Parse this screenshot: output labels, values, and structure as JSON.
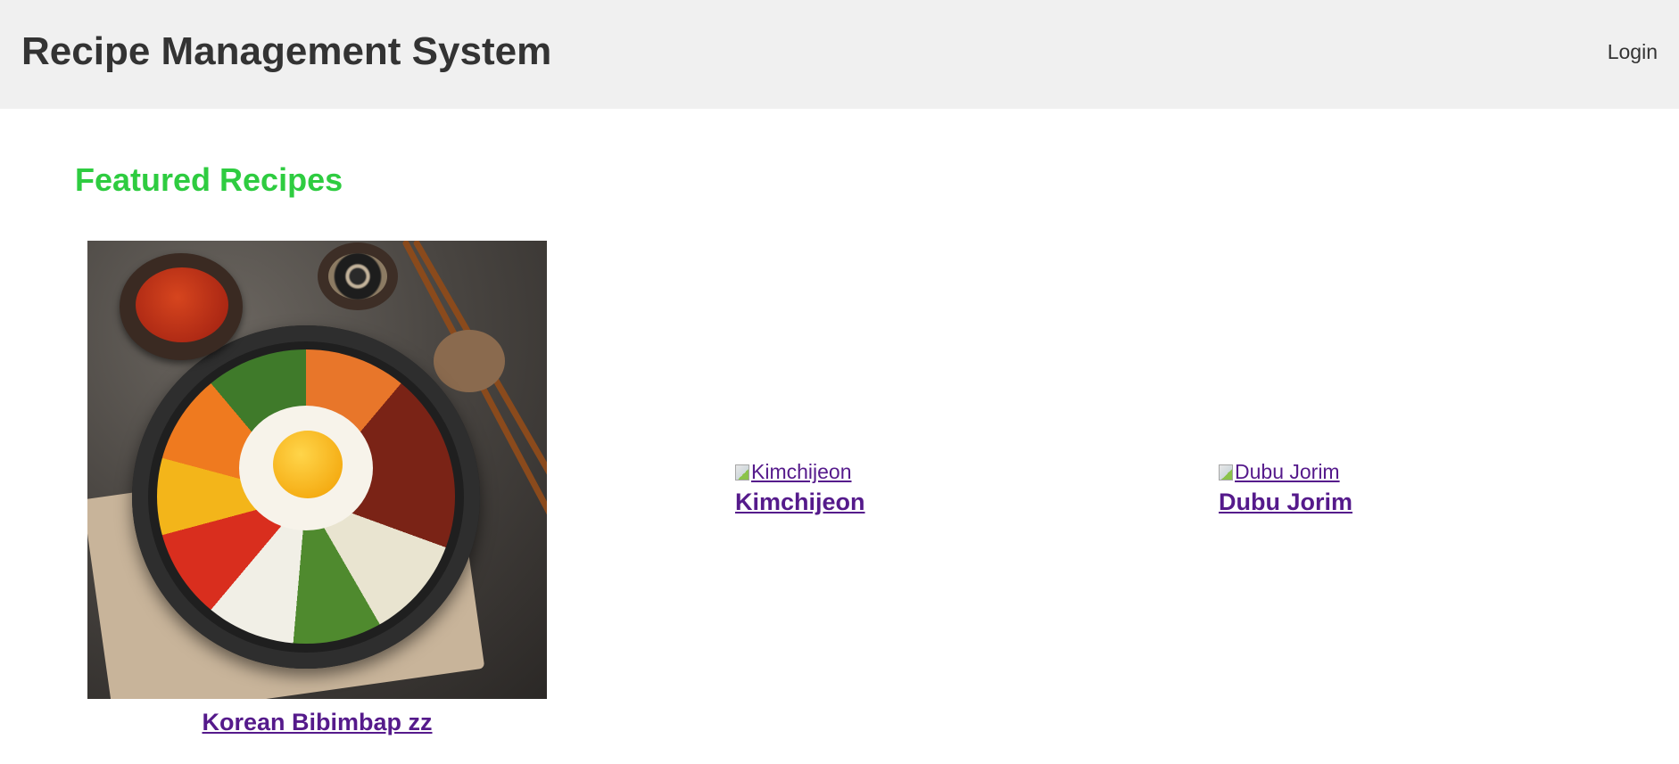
{
  "header": {
    "title": "Recipe Management System",
    "login_label": "Login"
  },
  "main": {
    "section_title": "Featured Recipes",
    "recipes": [
      {
        "title": "Korean Bibimbap zz",
        "image_alt": "Korean Bibimbap zz",
        "image_loaded": true
      },
      {
        "title": "Kimchijeon",
        "image_alt": "Kimchijeon",
        "image_loaded": false
      },
      {
        "title": "Dubu Jorim",
        "image_alt": "Dubu Jorim",
        "image_loaded": false
      }
    ]
  },
  "colors": {
    "header_bg": "#f0f0f0",
    "title_text": "#333333",
    "section_title": "#2ecc40",
    "visited_link": "#551a8b"
  }
}
